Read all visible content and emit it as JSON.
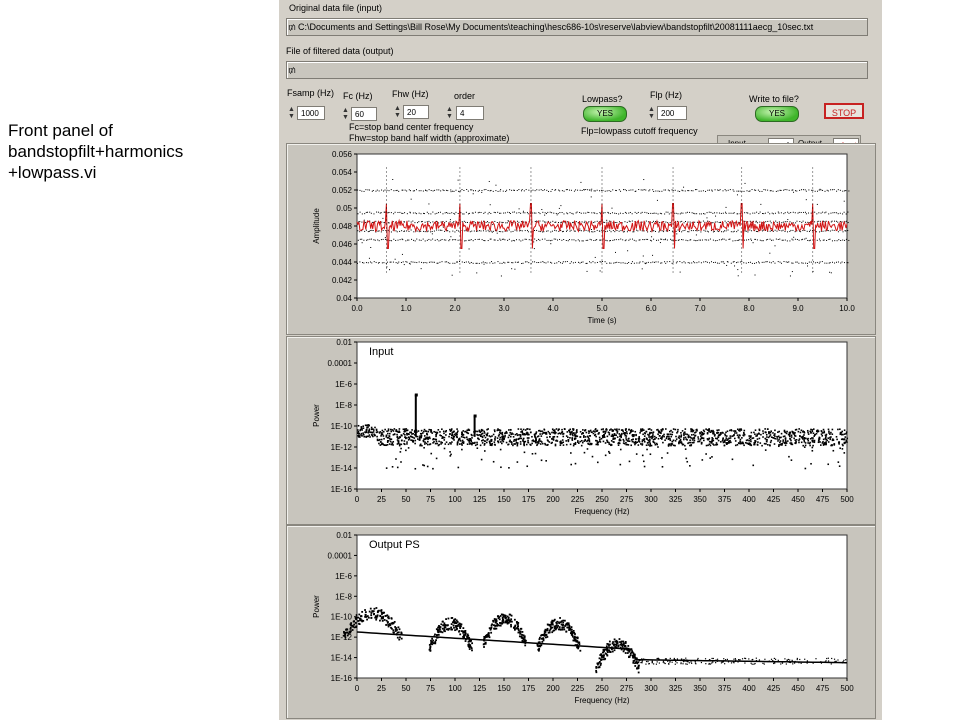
{
  "caption": {
    "line1": "Front panel of",
    "line2": "bandstopfilt+harmonics",
    "line3": "+lowpass.vi"
  },
  "inputs": {
    "original_label": "Original data file (input)",
    "original_path": "C:\\Documents and Settings\\Bill Rose\\My Documents\\teaching\\hesc686-10s\\reserve\\labview\\bandstopfilt\\20081111aecg_10sec.txt",
    "filtered_label": "File of filtered data (output)",
    "filtered_path": "",
    "path_icon": "folder-path-icon"
  },
  "controls": {
    "fsamp_label": "Fsamp (Hz)",
    "fsamp_value": "1000",
    "fc_label": "Fc (Hz)",
    "fc_value": "60",
    "fhw_label": "Fhw (Hz)",
    "fhw_value": "20",
    "order_label": "order",
    "order_value": "4",
    "lowpass_label": "Lowpass?",
    "lowpass_value": "YES",
    "flp_label": "Flp (Hz)",
    "flp_value": "200",
    "write_label": "Write to file?",
    "write_value": "YES",
    "stop_label": "STOP",
    "note1": "Fc=stop band center frequency",
    "note2": "Fhw=stop band half width (approximate)",
    "note3": "Flp=lowpass cutoff frequency"
  },
  "legend": {
    "input": "Input",
    "output": "Output"
  },
  "colors": {
    "panel": "#d4d0c8",
    "output_trace": "#d11414",
    "points": "#000000",
    "stop": "#c72222"
  },
  "chart_data": [
    {
      "type": "line",
      "title": "",
      "xlabel": "Time (s)",
      "ylabel": "Amplitude",
      "xlim": [
        0,
        10
      ],
      "ylim": [
        0.04,
        0.056
      ],
      "xticks": [
        "0.0",
        "1.0",
        "2.0",
        "3.0",
        "4.0",
        "5.0",
        "6.0",
        "7.0",
        "8.0",
        "9.0",
        "10.0"
      ],
      "yticks": [
        "0.04",
        "0.042",
        "0.044",
        "0.046",
        "0.048",
        "0.05",
        "0.052",
        "0.054",
        "0.056"
      ],
      "series": [
        {
          "name": "Input",
          "style": "points",
          "levels": [
            0.044,
            0.0465,
            0.0475,
            0.0485,
            0.0495,
            0.052
          ]
        },
        {
          "name": "Output",
          "style": "line",
          "baseline": 0.048,
          "spike_times": [
            0.6,
            2.1,
            3.55,
            5.0,
            6.45,
            7.85,
            9.3
          ]
        }
      ]
    },
    {
      "type": "scatter",
      "title": "Input",
      "xlabel": "Frequency (Hz)",
      "ylabel": "Power",
      "xlim": [
        0,
        500
      ],
      "y_scale": "log",
      "yticks": [
        "0.01",
        "0.0001",
        "1E-6",
        "1E-8",
        "1E-10",
        "1E-12",
        "1E-14",
        "1E-16"
      ],
      "xticks": [
        "0",
        "25",
        "50",
        "75",
        "100",
        "125",
        "150",
        "175",
        "200",
        "225",
        "250",
        "275",
        "300",
        "325",
        "350",
        "375",
        "400",
        "425",
        "450",
        "475",
        "500"
      ],
      "peaks": [
        {
          "x": 60,
          "y": 1e-07
        },
        {
          "x": 120,
          "y": 1e-09
        }
      ],
      "band_low": 1e-12,
      "band_high": 1e-10
    },
    {
      "type": "scatter",
      "title": "Output PS",
      "xlabel": "Frequency (Hz)",
      "ylabel": "Power",
      "xlim": [
        0,
        500
      ],
      "y_scale": "log",
      "yticks": [
        "0.01",
        "0.0001",
        "1E-6",
        "1E-8",
        "1E-10",
        "1E-12",
        "1E-14",
        "1E-16"
      ],
      "xticks": [
        "0",
        "25",
        "50",
        "75",
        "100",
        "125",
        "150",
        "175",
        "200",
        "225",
        "250",
        "275",
        "300",
        "325",
        "350",
        "375",
        "400",
        "425",
        "450",
        "475",
        "500"
      ],
      "lobes": [
        {
          "x": 15,
          "y": 1e-09
        },
        {
          "x": 95,
          "y": 1e-10
        },
        {
          "x": 150,
          "y": 3e-10
        },
        {
          "x": 205,
          "y": 1e-10
        },
        {
          "x": 265,
          "y": 1e-12
        }
      ],
      "floor_y": 1e-14,
      "floor_end_y": 3e-15
    }
  ]
}
